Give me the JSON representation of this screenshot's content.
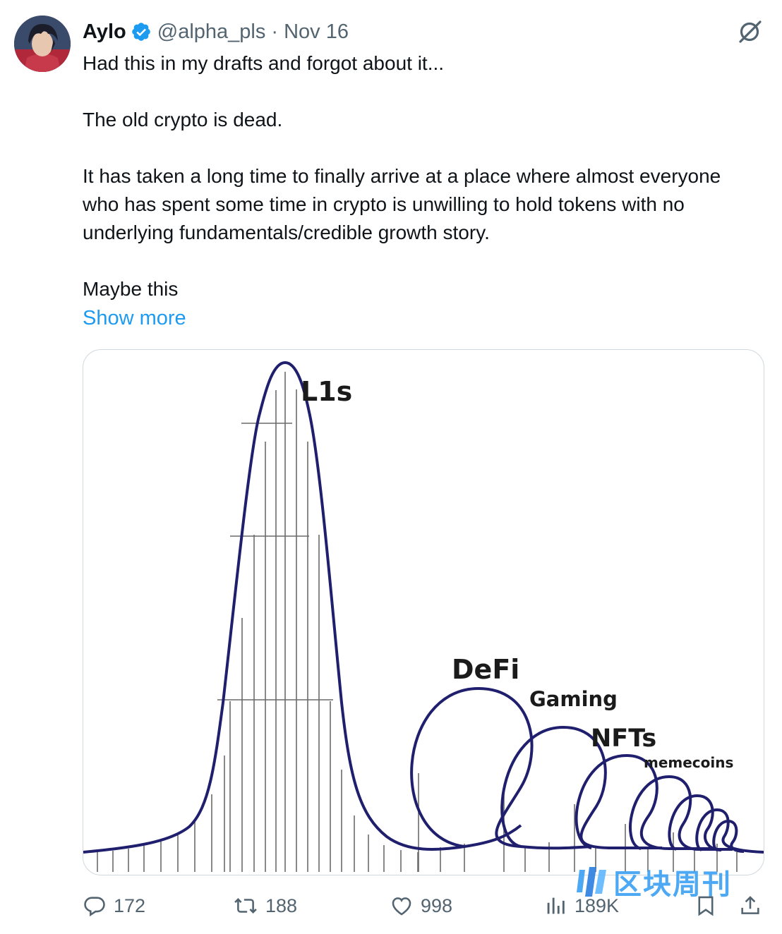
{
  "author": {
    "name": "Aylo",
    "handle": "@alpha_pls",
    "separator": "·",
    "date": "Nov 16"
  },
  "body": {
    "paragraphs": [
      "Had this in my drafts and forgot about it...",
      "The old crypto is dead.",
      "It has taken a long time to finally arrive at a place where almost everyone who has spent some time in crypto is unwilling to hold tokens with no underlying fundamentals/credible growth story.",
      "Maybe this"
    ],
    "show_more": "Show more"
  },
  "image": {
    "labels": {
      "l1s": "L1s",
      "defi": "DeFi",
      "gaming": "Gaming",
      "nfts": "NFTs",
      "memecoins": "memecoins"
    },
    "track_color": "#1f1f6e"
  },
  "actions": {
    "replies": "172",
    "reposts": "188",
    "likes": "998",
    "views": "189K"
  },
  "watermark": {
    "text": "区块周刊"
  },
  "colors": {
    "link": "#1d9bf0",
    "verified": "#1d9bf0",
    "muted": "#536471"
  }
}
